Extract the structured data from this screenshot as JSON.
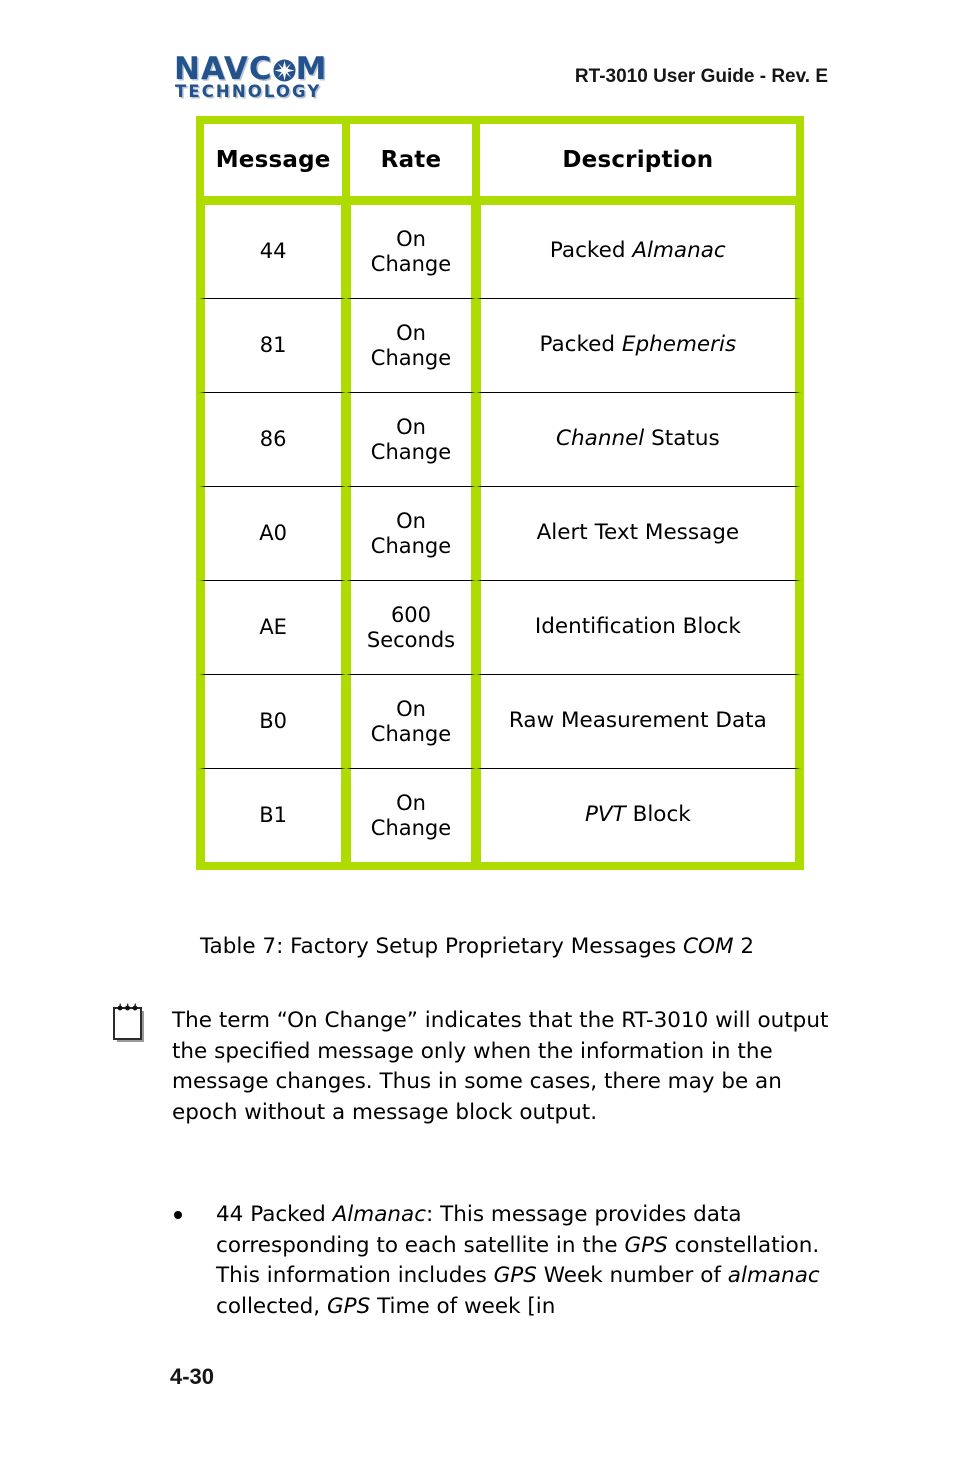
{
  "header": {
    "logo_top": "NAVC",
    "logo_top_after": "M",
    "logo_bottom": "TECHNOLOGY",
    "title": "RT-3010 User Guide - Rev. E"
  },
  "table": {
    "columns": [
      "Message",
      "Rate",
      "Description"
    ],
    "rows": [
      {
        "message": "44",
        "rate": "On Change",
        "description_pre": "Packed ",
        "description_em": "Almanac",
        "description_post": ""
      },
      {
        "message": "81",
        "rate": "On Change",
        "description_pre": "Packed ",
        "description_em": "Ephemeris",
        "description_post": ""
      },
      {
        "message": "86",
        "rate": "On Change",
        "description_pre": "",
        "description_em": "Channel",
        "description_post": " Status"
      },
      {
        "message": "A0",
        "rate": "On Change",
        "description_pre": "Alert Text Message",
        "description_em": "",
        "description_post": ""
      },
      {
        "message": "AE",
        "rate": "600 Seconds",
        "description_pre": "Identification Block",
        "description_em": "",
        "description_post": ""
      },
      {
        "message": "B0",
        "rate": "On Change",
        "description_pre": "Raw Measurement Data",
        "description_em": "",
        "description_post": ""
      },
      {
        "message": "B1",
        "rate": "On Change",
        "description_pre": "",
        "description_em": "PVT",
        "description_post": " Block"
      }
    ],
    "caption_pre": "Table 7: Factory Setup Proprietary Messages ",
    "caption_em": "COM",
    "caption_post": " 2"
  },
  "note": {
    "icon": "notepad-icon",
    "text": "The term “On Change” indicates that the RT-3010 will output the specified message only when the information in the message changes. Thus in some cases, there may be an epoch without a message block output."
  },
  "bullets": [
    {
      "seg1": "44 Packed ",
      "em1": "Almanac",
      "seg2": ": This message provides data corresponding to each satellite in the ",
      "em2": "GPS",
      "seg3": " constellation. This information includes ",
      "em3": "GPS",
      "seg4": " Week number of ",
      "em4": "almanac",
      "seg5": " collected, ",
      "em5": "GPS",
      "seg6": " Time of week [in"
    }
  ],
  "footer": {
    "page_number": "4-30"
  },
  "colors": {
    "table_border_outer": "#aedb00",
    "table_border_inner": "#5f8000",
    "logo_blue": "#23528c"
  }
}
